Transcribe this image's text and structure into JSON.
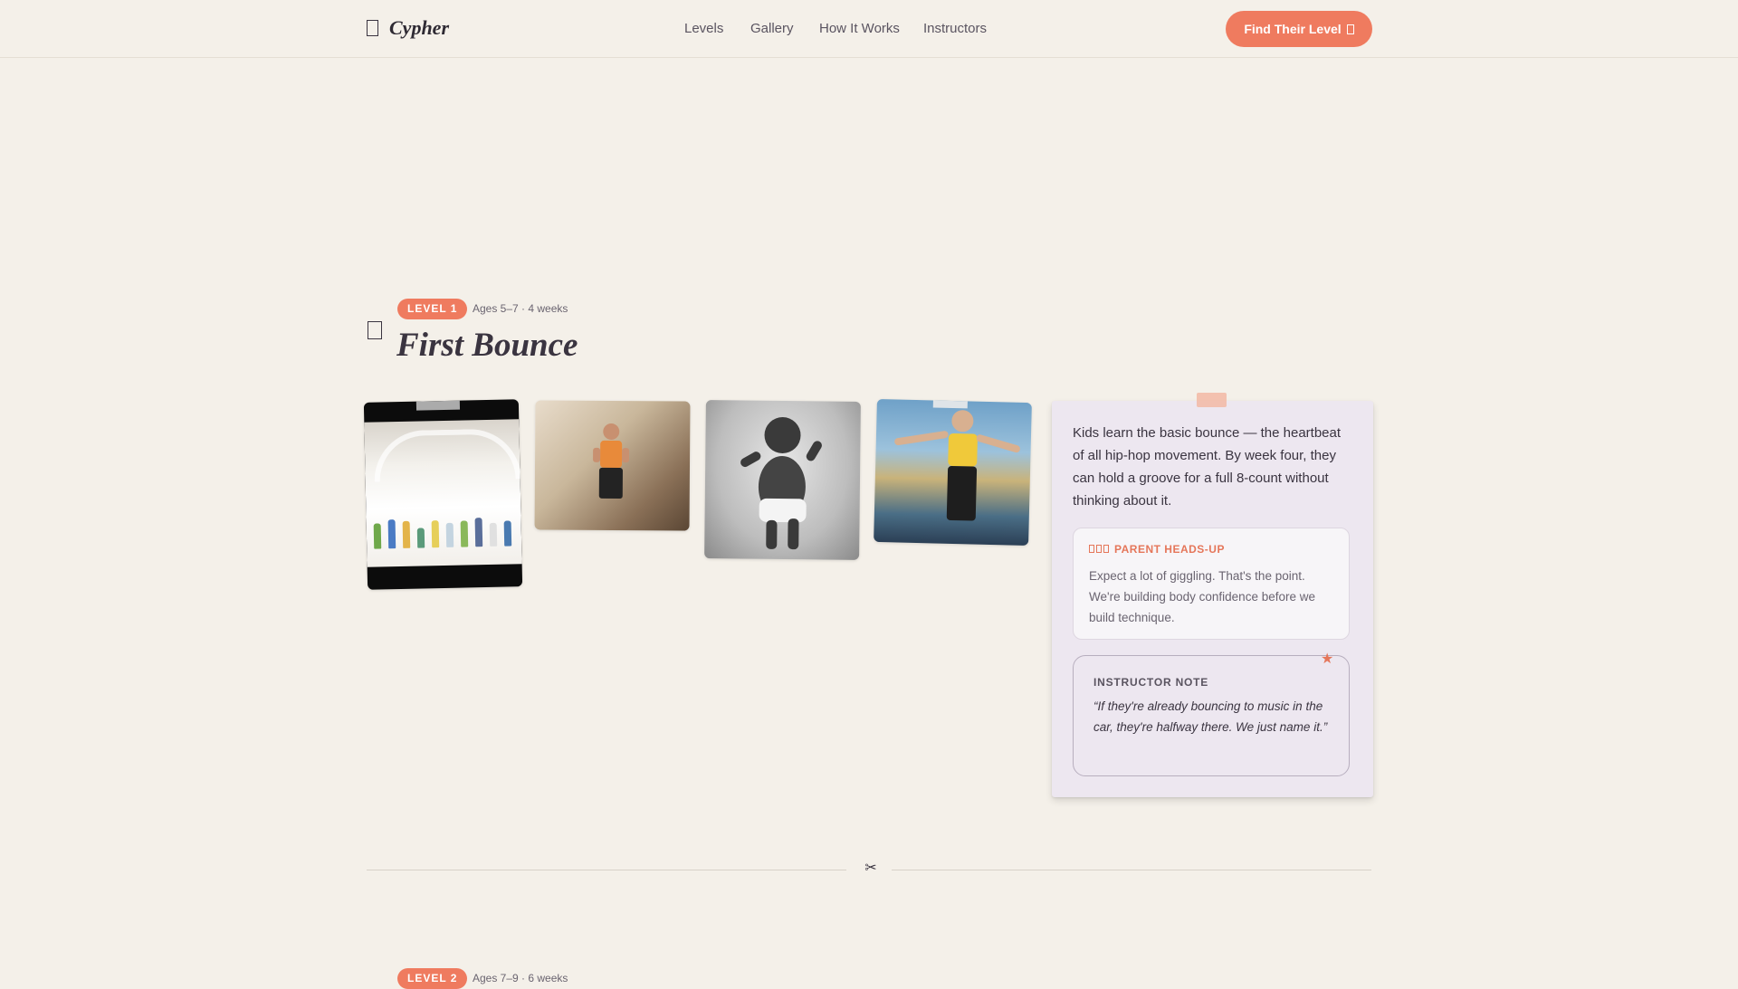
{
  "nav": {
    "brand": "Cypher",
    "links": [
      "Levels",
      "Gallery",
      "How It Works",
      "Instructors"
    ],
    "cta_label": "Find Their Level"
  },
  "level1": {
    "badge": "LEVEL 1",
    "meta": "Ages 5–7 · 4 weeks",
    "title": "First Bounce",
    "description": "Kids learn the basic bounce — the heartbeat of all hip-hop movement. By week four, they can hold a groove for a full 8-count without thinking about it.",
    "parent_headsup": {
      "title": "PARENT HEADS-UP",
      "body": "Expect a lot of giggling. That's the point. We're building body confidence before we build technique."
    },
    "instructor_note": {
      "title": "INSTRUCTOR NOTE",
      "quote": "“If they're already bouncing to music in the car, they're halfway there. We just name it.”"
    }
  },
  "level2": {
    "badge": "LEVEL 2",
    "meta": "Ages 7–9 · 6 weeks"
  },
  "colors": {
    "accent": "#ef7b5f",
    "background": "#f4f0e9",
    "note_card": "#ede7f0"
  },
  "icons": {
    "logo": "book-icon",
    "cta": "arrow-icon",
    "level": "book-icon",
    "divider": "scissors-icon",
    "instructor": "star-icon"
  }
}
